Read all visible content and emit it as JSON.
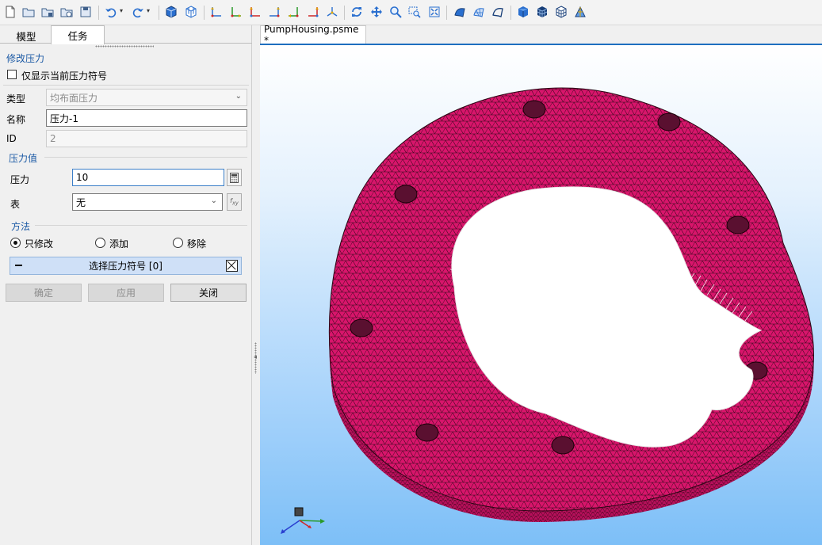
{
  "toolbar": {
    "icons": [
      "new-file-icon",
      "open-folder-icon",
      "open-folder-2-icon",
      "open-recent-icon",
      "save-icon",
      "undo-icon",
      "redo-icon",
      "cube-view-icon",
      "cube-grid-icon",
      "axis-x-icon",
      "axis-y-icon",
      "axis-z-icon",
      "axis-neg-x-icon",
      "axis-neg-y-icon",
      "axis-neg-z-icon",
      "axis-iso-icon",
      "rotate-icon",
      "pan-icon",
      "zoom-icon",
      "zoom-window-icon",
      "fit-all-icon",
      "surface-icon",
      "mesh-icon",
      "outline-icon",
      "solid-cube-icon",
      "wire-cube-icon",
      "hidden-line-cube-icon",
      "perspective-icon"
    ],
    "colors": {
      "blue": "#2a6fcf",
      "green": "#2a9a2a",
      "red": "#d02626",
      "yellow": "#e0a800"
    }
  },
  "left_panel": {
    "tabs": [
      {
        "label": "模型"
      },
      {
        "label": "任务"
      }
    ],
    "active_tab": "任务",
    "section_title": "修改压力",
    "only_current_label": "仅显示当前压力符号",
    "type": {
      "label": "类型",
      "value": "均布面压力"
    },
    "name": {
      "label": "名称",
      "value": "压力-1"
    },
    "id": {
      "label": "ID",
      "value": "2"
    },
    "pressure_group": {
      "title": "压力值",
      "pressure_label": "压力",
      "pressure_value": "10",
      "table_label": "表",
      "table_value": "无"
    },
    "method": {
      "title": "方法",
      "options": [
        {
          "label": "只修改",
          "selected": true
        },
        {
          "label": "添加",
          "selected": false
        },
        {
          "label": "移除",
          "selected": false
        }
      ]
    },
    "select_bar_label": "选择压力符号 [0]",
    "buttons": {
      "ok": "确定",
      "apply": "应用",
      "close": "关闭"
    }
  },
  "document": {
    "tab_label": "PumpHousing.psme *",
    "mesh_color": "#d8156b",
    "background_top": "#ffffff",
    "background_bottom": "#7dbff7"
  }
}
